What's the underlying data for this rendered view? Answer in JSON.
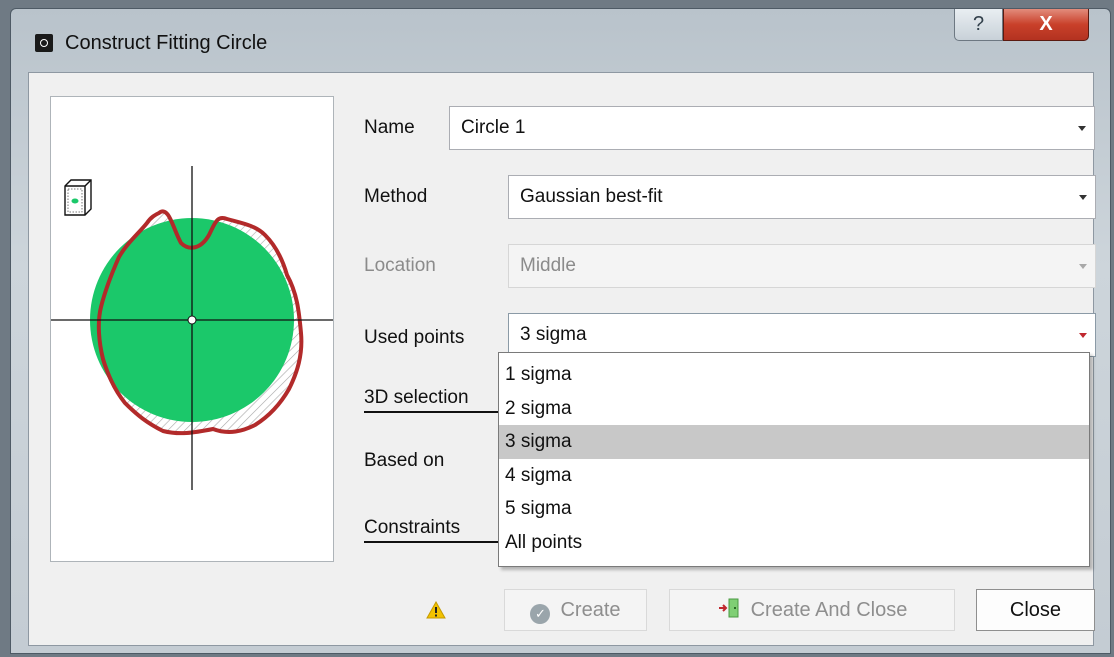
{
  "window": {
    "title": "Construct Fitting Circle",
    "help_glyph": "?",
    "close_glyph": "X"
  },
  "form": {
    "name_label": "Name",
    "name_value": "Circle 1",
    "method_label": "Method",
    "method_value": "Gaussian best-fit",
    "location_label": "Location",
    "location_value": "Middle",
    "used_points_label": "Used points",
    "used_points_value": "3 sigma",
    "selection_3d_label": "3D selection",
    "based_on_label": "Based on",
    "constraints_label": "Constraints"
  },
  "used_points_options": [
    "1 sigma",
    "2 sigma",
    "3 sigma",
    "4 sigma",
    "5 sigma",
    "All points"
  ],
  "used_points_selected_index": 2,
  "buttons": {
    "create": "Create",
    "create_and_close": "Create And Close",
    "close": "Close"
  },
  "colors": {
    "circle_fill": "#1bc86a",
    "measured_outline": "#b22a2a",
    "warning": "#f2c200"
  },
  "icons": {
    "title": "dialog-icon",
    "cube": "cube-view-icon",
    "warning": "warning-icon",
    "create": "check-circle-icon",
    "create_and_close": "door-exit-icon"
  }
}
